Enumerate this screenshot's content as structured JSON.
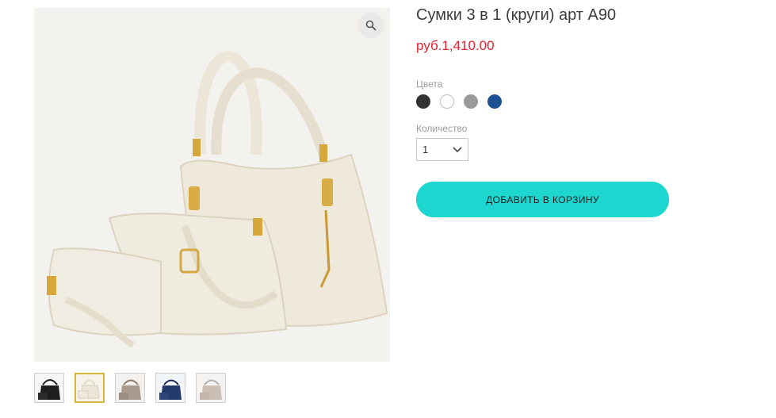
{
  "product": {
    "title": "Сумки 3 в 1 (круги) арт А90",
    "price": "руб.1,410.00"
  },
  "gallery": {
    "zoom_icon": "magnifier-icon",
    "thumbnails": [
      {
        "name": "black",
        "selected": false
      },
      {
        "name": "white",
        "selected": true
      },
      {
        "name": "grey-brown",
        "selected": false
      },
      {
        "name": "blue",
        "selected": false
      },
      {
        "name": "silver",
        "selected": false
      }
    ]
  },
  "options": {
    "colors_label": "Цвета",
    "colors": [
      "#333333",
      "#ffffff",
      "#9a9a9a",
      "#1d4f91"
    ],
    "quantity_label": "Количество",
    "quantity_value": "1"
  },
  "actions": {
    "add_to_cart": "ДОБАВИТЬ В КОРЗИНУ"
  },
  "theme": {
    "accent": "#1ed6d0",
    "price_color": "#e8212d",
    "selected_thumb_border": "#d9b43a"
  }
}
